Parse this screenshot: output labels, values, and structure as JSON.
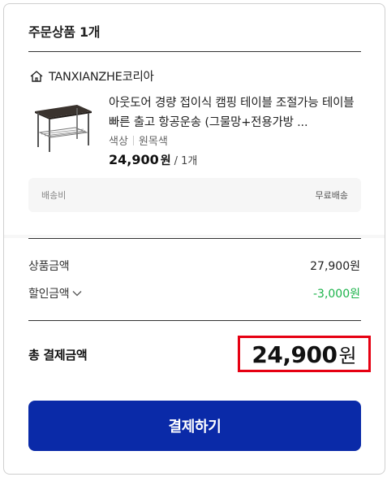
{
  "header": {
    "title": "주문상품 1개"
  },
  "seller": {
    "name": "TANXIANZHE코리아",
    "icon": "store-icon"
  },
  "product": {
    "image_icon": "camping-table-image",
    "name": "아웃도어 경량 접이식 캠핑 테이블 조절가능 테이블 빠른 출고 항공운송 (그물망+전용가방 ...",
    "option_label": "색상",
    "option_value": "원목색",
    "price": "24,900",
    "price_unit": "원",
    "quantity": "/ 1개"
  },
  "shipping": {
    "label": "배송비",
    "value": "무료배송"
  },
  "summary": {
    "product_amount_label": "상품금액",
    "product_amount_value": "27,900원",
    "discount_label": "할인금액",
    "discount_value": "-3,000원"
  },
  "total": {
    "label": "총 결제금액",
    "amount": "24,900",
    "unit": "원"
  },
  "pay_button": {
    "label": "결제하기"
  },
  "colors": {
    "accent": "#0a2aa8",
    "discount": "#1bb34a",
    "highlight_border": "#e60012"
  }
}
